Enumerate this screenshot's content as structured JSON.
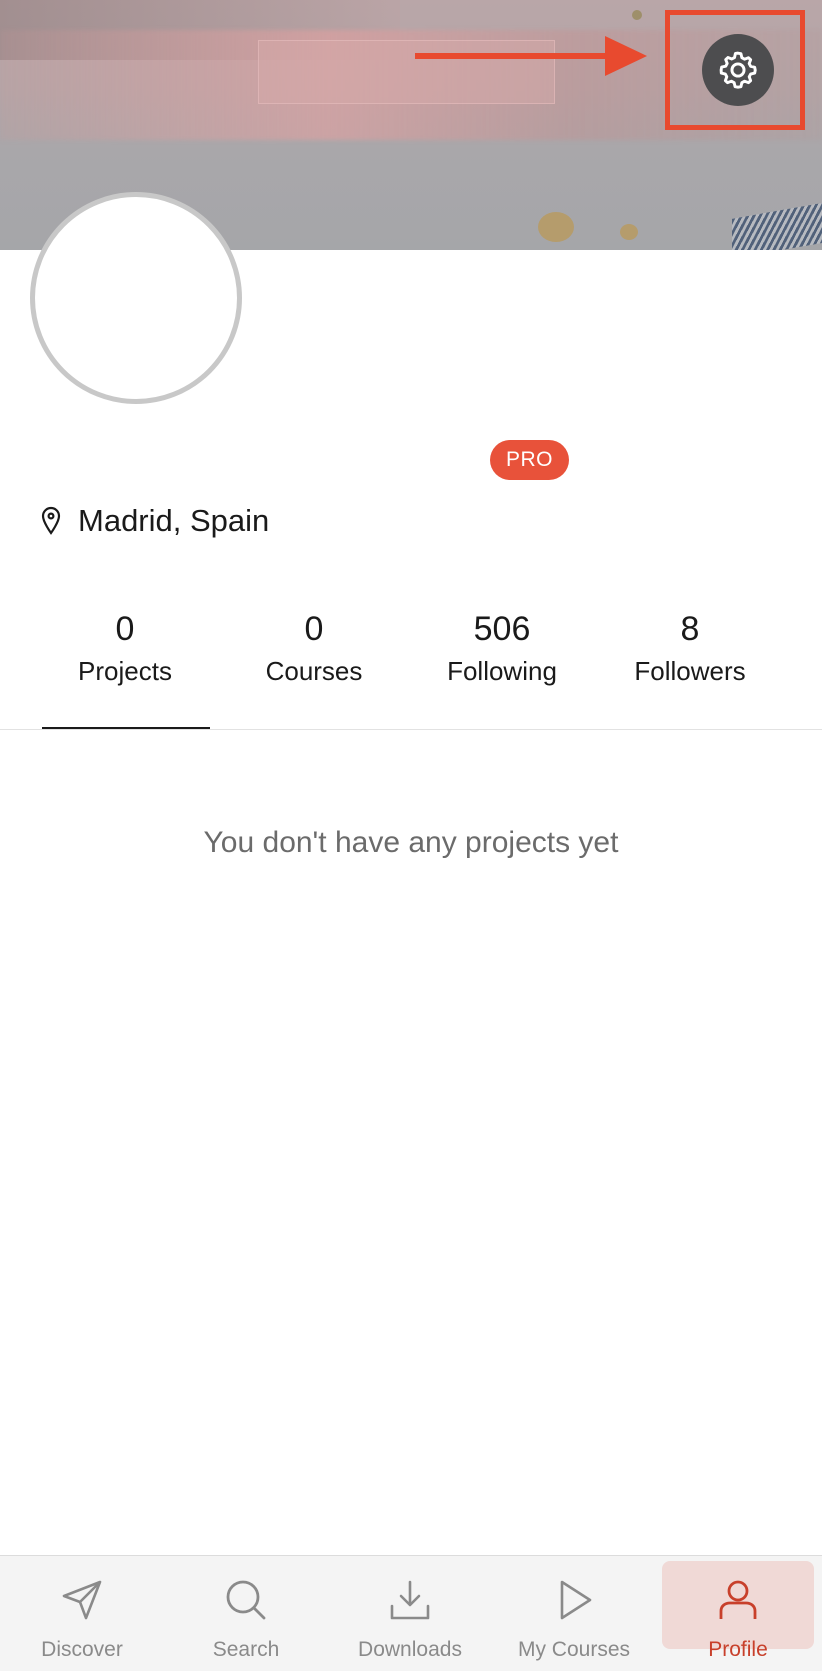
{
  "header": {
    "settings_icon": "gear-icon",
    "annotation_color": "#e84a2f"
  },
  "profile": {
    "badge": "PRO",
    "location": "Madrid, Spain",
    "location_icon": "map-pin-icon"
  },
  "stats": [
    {
      "value": "0",
      "label": "Projects"
    },
    {
      "value": "0",
      "label": "Courses"
    },
    {
      "value": "506",
      "label": "Following"
    },
    {
      "value": "8",
      "label": "Followers"
    }
  ],
  "content": {
    "empty_message": "You don't have any projects yet"
  },
  "bottom_nav": [
    {
      "label": "Discover",
      "icon": "send-icon"
    },
    {
      "label": "Search",
      "icon": "search-icon"
    },
    {
      "label": "Downloads",
      "icon": "download-icon"
    },
    {
      "label": "My Courses",
      "icon": "play-icon"
    },
    {
      "label": "Profile",
      "icon": "user-icon",
      "active": true
    }
  ],
  "colors": {
    "accent": "#e8523a",
    "active_nav_text": "#c8402b",
    "active_nav_bg": "#f0d9d6"
  }
}
